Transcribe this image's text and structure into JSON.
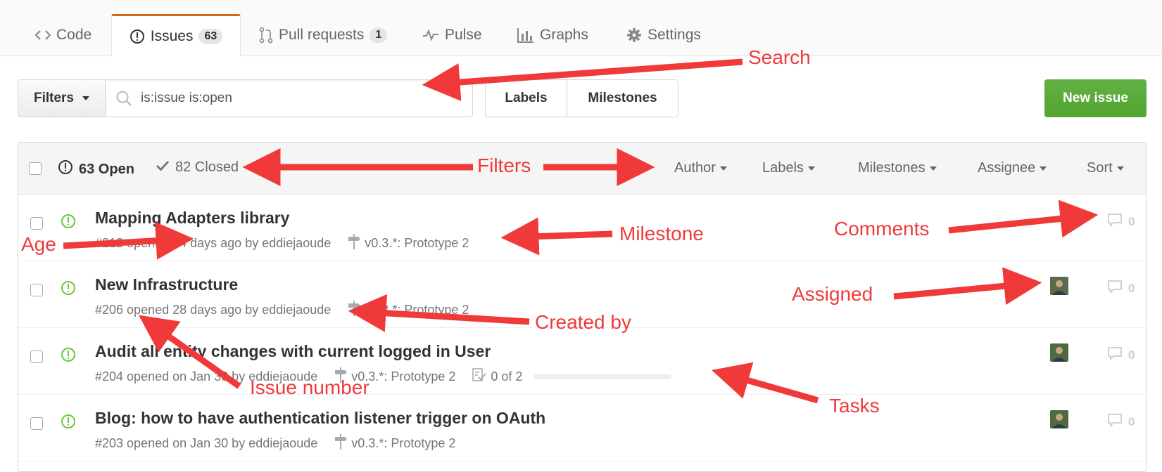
{
  "tabs": [
    {
      "label": "Code",
      "icon": "code-icon"
    },
    {
      "label": "Issues",
      "count": "63",
      "icon": "issue-opened-icon",
      "selected": true
    },
    {
      "label": "Pull requests",
      "count": "1",
      "icon": "git-pull-request-icon"
    },
    {
      "label": "Pulse",
      "icon": "pulse-icon"
    },
    {
      "label": "Graphs",
      "icon": "graph-icon"
    },
    {
      "label": "Settings",
      "icon": "gear-icon"
    }
  ],
  "subnav": {
    "filters_label": "Filters",
    "search_value": "is:issue is:open",
    "labels_label": "Labels",
    "milestones_label": "Milestones",
    "new_issue_label": "New issue"
  },
  "header": {
    "open_label": "63 Open",
    "closed_label": "82 Closed",
    "filters": [
      "Author",
      "Labels",
      "Milestones",
      "Assignee",
      "Sort"
    ]
  },
  "issues": [
    {
      "title": "Mapping Adapters library",
      "meta": "#212 opened 14 days ago by eddiejaoude",
      "milestone": "v0.3.*: Prototype 2",
      "comments": "0",
      "assigned": false
    },
    {
      "title": "New Infrastructure",
      "meta": "#206 opened 28 days ago by eddiejaoude",
      "milestone": "v0.3.*: Prototype 2",
      "comments": "0",
      "assigned": true
    },
    {
      "title": "Audit all entity changes with current logged in User",
      "meta": "#204 opened on Jan 30 by eddiejaoude",
      "milestone": "v0.3.*: Prototype 2",
      "tasks": "0 of 2",
      "tasks_progress": 0,
      "comments": "0",
      "assigned": true
    },
    {
      "title": "Blog: how to have authentication listener trigger on OAuth",
      "meta": "#203 opened on Jan 30 by eddiejaoude",
      "milestone": "v0.3.*: Prototype 2",
      "comments": "0",
      "assigned": true
    }
  ],
  "annotations": {
    "search": "Search",
    "filters": "Filters",
    "milestone": "Milestone",
    "comments": "Comments",
    "age": "Age",
    "assigned": "Assigned",
    "created_by": "Created by",
    "issue_number": "Issue number",
    "tasks": "Tasks"
  },
  "colors": {
    "accent_tab": "#d26911",
    "open_green": "#6cc644",
    "new_issue_green": "#55a532",
    "annotation_red": "#f03a3a"
  }
}
